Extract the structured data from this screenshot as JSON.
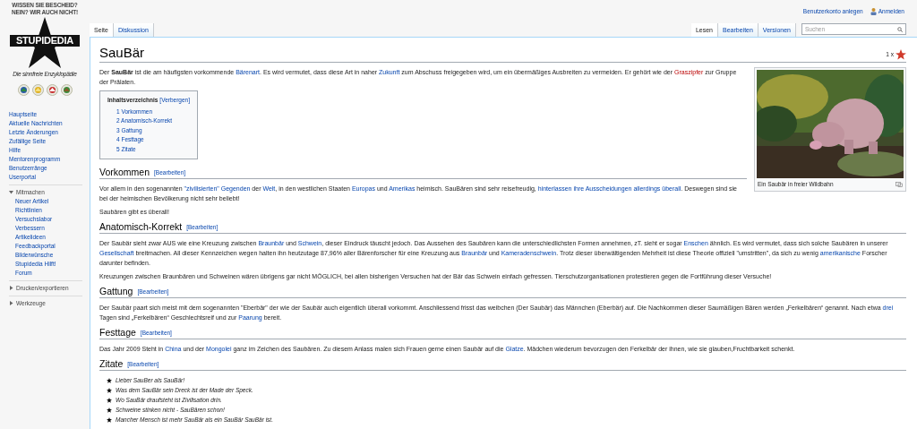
{
  "logo": {
    "slogan_top": "WISSEN SIE BESCHEID?",
    "slogan_bottom": "NEIN? WIR AUCH NICHT!",
    "name": "STUPIDEDIA",
    "tagline": "Die sinnfreie Enzyklopädie"
  },
  "nav": [
    "Hauptseite",
    "Aktuelle Nachrichten",
    "Letzte Änderungen",
    "Zufällige Seite",
    "Hilfe",
    "Mentorenprogramm",
    "Benutzerränge",
    "Userportal"
  ],
  "portlets": [
    {
      "title": "Mitmachen",
      "expanded": true,
      "items": [
        "Neuer Artikel",
        "Richtlinien",
        "Versuchslabor",
        "Verbessern",
        "Artikelideen",
        "Feedbackportal",
        "Bilderwünsche",
        "Stupidedia Hilft!",
        "Forum"
      ]
    },
    {
      "title": "Drucken/exportieren",
      "expanded": false
    },
    {
      "title": "Werkzeuge",
      "expanded": false
    }
  ],
  "personal_tools": [
    {
      "label": "Benutzerkonto anlegen",
      "kind": "text"
    },
    {
      "label": "Anmelden",
      "kind": "user"
    }
  ],
  "left_tabs": [
    {
      "label": "Seite",
      "selected": true
    },
    {
      "label": "Diskussion",
      "selected": false
    }
  ],
  "right_tabs": [
    {
      "label": "Lesen",
      "selected": true
    },
    {
      "label": "Bearbeiten",
      "selected": false
    },
    {
      "label": "Versionen",
      "selected": false
    }
  ],
  "search": {
    "placeholder": "Suchen"
  },
  "title": "SauBär",
  "rating": "1 x",
  "intro": [
    {
      "text": "Der "
    },
    {
      "text": "SauBär",
      "kind": "bold"
    },
    {
      "text": " ist die am häufigsten vorkommende "
    },
    {
      "text": "Bärenart",
      "kind": "link"
    },
    {
      "text": ". Es wird vermutet, dass diese Art in naher "
    },
    {
      "text": "Zukunft",
      "kind": "link"
    },
    {
      "text": " zum Abschuss freigegeben wird, um ein übermäßiges Ausbreiten zu vermeiden. Er gehört wie der "
    },
    {
      "text": "Graszipfer",
      "kind": "redlink"
    },
    {
      "text": " zur Gruppe der Prälaten."
    }
  ],
  "toc": {
    "title": "Inhaltsverzeichnis",
    "toggle": "[Verbergen]",
    "items": [
      "1 Vorkommen",
      "2 Anatomisch-Korrekt",
      "3 Gattung",
      "4 Festtage",
      "5 Zitate"
    ]
  },
  "figure": {
    "caption": "Ein Saubär in freier Wildbahn"
  },
  "sections": [
    {
      "heading": "Vorkommen",
      "edit": "[Bearbeiten]",
      "kind": "text",
      "paragraphs": [
        [
          {
            "text": "Vor allem in den sogenannten "
          },
          {
            "text": "\"zivilisierten\" Gegenden",
            "kind": "link"
          },
          {
            "text": " der "
          },
          {
            "text": "Welt",
            "kind": "link"
          },
          {
            "text": ", in den westlichen Staaten "
          },
          {
            "text": "Europas",
            "kind": "link"
          },
          {
            "text": " und "
          },
          {
            "text": "Amerikas",
            "kind": "link"
          },
          {
            "text": " heimisch. SauBären sind sehr reisefreudig, "
          },
          {
            "text": "hinterlassen ihre Ausscheidungen allerdings überall",
            "kind": "link"
          },
          {
            "text": ". Deswegen sind sie bei der heimischen Bevölkerung nicht sehr beliebt!"
          }
        ],
        [
          {
            "text": "Saubären gibt es überall!"
          }
        ]
      ]
    },
    {
      "heading": "Anatomisch-Korrekt",
      "edit": "[Bearbeiten]",
      "kind": "text",
      "paragraphs": [
        [
          {
            "text": "Der Saubär sieht zwar AUS wie eine Kreuzung zwischen "
          },
          {
            "text": "Braunbär",
            "kind": "link"
          },
          {
            "text": " und "
          },
          {
            "text": "Schwein",
            "kind": "link"
          },
          {
            "text": ", dieser Eindruck täuscht jedoch. Das Aussehen des Saubären kann die unterschiedlichsten Formen annehmen, zT. sieht er sogar "
          },
          {
            "text": "Enschen",
            "kind": "link"
          },
          {
            "text": " ähnlich. Es wird vermutet, dass sich solche Saubären in unserer "
          },
          {
            "text": "Gesellschaft",
            "kind": "link"
          },
          {
            "text": " breitmachen. All dieser Kennzeichen wegen halten ihn heutzutage 87,96% aller Bärenforscher für eine Kreuzung aus "
          },
          {
            "text": "Braunbär",
            "kind": "link"
          },
          {
            "text": " und "
          },
          {
            "text": "Kameradenschwein",
            "kind": "link"
          },
          {
            "text": ". Trotz dieser überwältigenden Mehrheit ist diese Theorie offiziell \"umstritten\", da sich zu wenig "
          },
          {
            "text": "amerikanische",
            "kind": "link"
          },
          {
            "text": " Forscher darunter befinden."
          }
        ],
        [
          {
            "text": "Kreuzungen zwischen Braunbären und Schweinen wären übrigens gar nicht MÖGLICH, bei allen bisherigen Versuchen hat der Bär das Schwein einfach gefressen. Tierschutzorganisationen protestieren gegen die Fortführung dieser Versuche!"
          }
        ]
      ]
    },
    {
      "heading": "Gattung",
      "edit": "[Bearbeiten]",
      "kind": "text",
      "paragraphs": [
        [
          {
            "text": "Der Saubär paart sich meist mit dem sogenannten \"Eberbär\" der wie der Saubär auch eigentlich überall vorkommt. Anschliessend frisst das weibchen (Der Saubär) das Männchen (Eberbär) auf. Die Nachkommen dieser Saumäßigen Bären werden „Ferkelbären“ genannt. Nach etwa "
          },
          {
            "text": "drei",
            "kind": "link"
          },
          {
            "text": " Tagen sind „Ferkelbären“ Geschlechtsreif und zur "
          },
          {
            "text": "Paarung",
            "kind": "link"
          },
          {
            "text": " bereit."
          }
        ]
      ]
    },
    {
      "heading": "Festtage",
      "edit": "[Bearbeiten]",
      "kind": "text",
      "paragraphs": [
        [
          {
            "text": "Das Jahr 2009 Steht in "
          },
          {
            "text": "China",
            "kind": "link"
          },
          {
            "text": " und der "
          },
          {
            "text": "Mongolei",
            "kind": "link"
          },
          {
            "text": " ganz im Zeichen des Saubären. Zu diesem Anlass malen sich Frauen gerne einen Saubär auf die "
          },
          {
            "text": "Glatze",
            "kind": "link"
          },
          {
            "text": ". Mädchen wiederum bevorzugen den Ferkelbär der ihnen, wie sie glauben,Fruchtbarkeit schenkt."
          }
        ]
      ]
    },
    {
      "heading": "Zitate",
      "edit": "[Bearbeiten]",
      "kind": "quotes",
      "quotes": [
        "Lieber SauBer als SauBär!",
        "Was dem SauBär sein Dreck ist der Made der Speck.",
        "Wo SauBär draufsteht ist Zivilisation drin.",
        "Schweine stinken nicht - SauBären schon!",
        "Mancher Mensch ist mehr SauBär als ein SauBär SauBär ist."
      ]
    }
  ]
}
